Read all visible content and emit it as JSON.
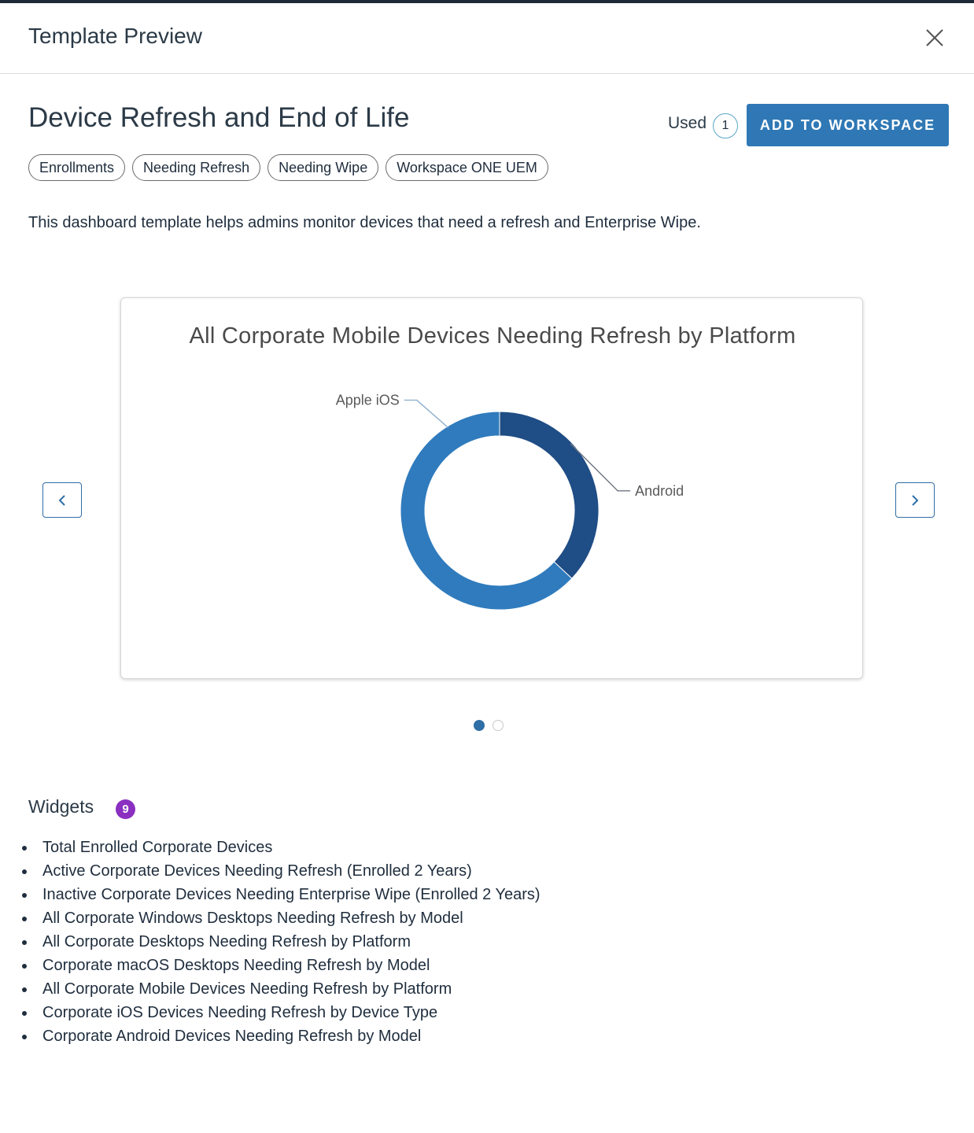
{
  "header": {
    "title": "Template Preview"
  },
  "template": {
    "title": "Device Refresh and End of Life",
    "used_label": "Used",
    "used_count": "1",
    "add_button_label": "ADD TO WORKSPACE",
    "tags": [
      "Enrollments",
      "Needing Refresh",
      "Needing Wipe",
      "Workspace ONE UEM"
    ],
    "description": "This dashboard template helps admins monitor devices that need a refresh and Enterprise Wipe."
  },
  "carousel": {
    "current_slide": 1,
    "total_slides": 2
  },
  "chart_data": {
    "type": "pie",
    "donut": true,
    "title": "All Corporate Mobile Devices Needing Refresh by Platform",
    "slices": [
      {
        "label": "Android",
        "value": 37,
        "color": "#1f4d85"
      },
      {
        "label": "Apple iOS",
        "value": 63,
        "color": "#2f7bbd"
      }
    ]
  },
  "widgets": {
    "heading": "Widgets",
    "count": "9",
    "items": [
      "Total Enrolled Corporate Devices",
      "Active Corporate Devices Needing Refresh (Enrolled 2 Years)",
      "Inactive Corporate Devices Needing Enterprise Wipe (Enrolled 2 Years)",
      "All Corporate Windows Desktops Needing Refresh by Model",
      "All Corporate Desktops Needing Refresh by Platform",
      "Corporate macOS Desktops Needing Refresh by Model",
      "All Corporate Mobile Devices Needing Refresh by Platform",
      "Corporate iOS Devices Needing Refresh by Device Type",
      "Corporate Android Devices Needing Refresh by Model"
    ]
  },
  "icons": {
    "close": "close-icon",
    "prev": "chevron-left-icon",
    "next": "chevron-right-icon"
  },
  "colors": {
    "accent": "#2f78b5",
    "badge_purple": "#8a2fc0"
  }
}
